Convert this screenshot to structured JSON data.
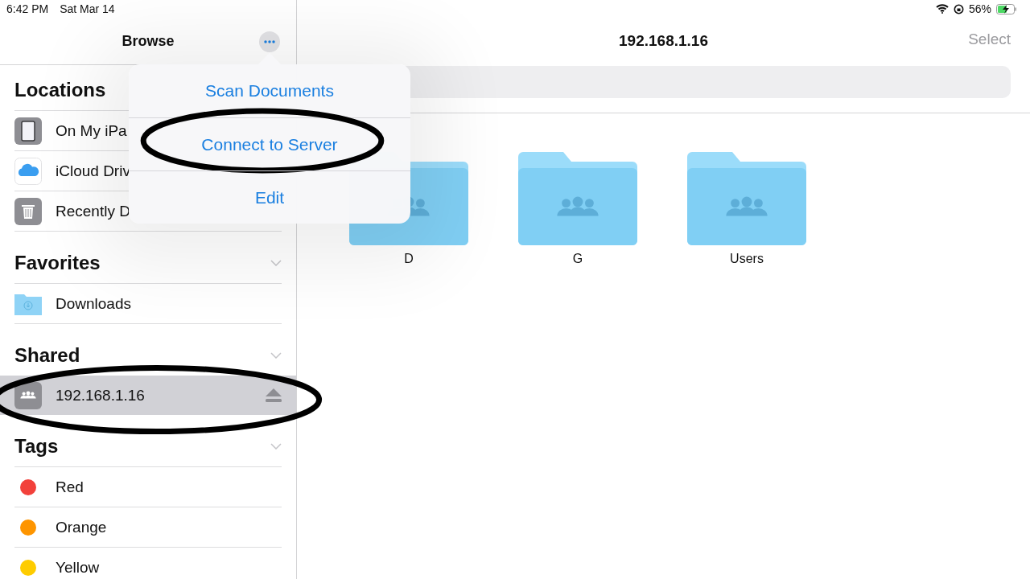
{
  "status_bar": {
    "time": "6:42 PM",
    "date": "Sat Mar 14",
    "battery": "56%",
    "charging": true
  },
  "sidebar": {
    "title": "Browse",
    "sections": [
      {
        "title": "Locations",
        "items": [
          {
            "kind": "device",
            "label": "On My iPa",
            "selected": false,
            "circled": false
          },
          {
            "kind": "cloud",
            "label": "iCloud Driv",
            "selected": false,
            "circled": false
          },
          {
            "kind": "trash",
            "label": "Recently D",
            "selected": false,
            "circled": false
          }
        ]
      },
      {
        "title": "Favorites",
        "chevron": true,
        "items": [
          {
            "kind": "folder",
            "label": "Downloads",
            "selected": false,
            "circled": false
          }
        ]
      },
      {
        "title": "Shared",
        "chevron": true,
        "items": [
          {
            "kind": "server",
            "label": "192.168.1.16",
            "selected": true,
            "circled": true,
            "ejectable": true
          }
        ]
      },
      {
        "title": "Tags",
        "chevron": true,
        "items": [
          {
            "kind": "tag",
            "label": "Red",
            "color": "#f2413b"
          },
          {
            "kind": "tag",
            "label": "Orange",
            "color": "#fe9500"
          },
          {
            "kind": "tag",
            "label": "Yellow",
            "color": "#fecc00"
          }
        ]
      }
    ]
  },
  "content": {
    "title": "192.168.1.16",
    "select": "Select",
    "folders": [
      {
        "name": "D"
      },
      {
        "name": "G"
      },
      {
        "name": "Users"
      }
    ]
  },
  "popover": {
    "items": [
      {
        "label": "Scan Documents",
        "circled": false
      },
      {
        "label": "Connect to Server",
        "circled": true
      },
      {
        "label": "Edit",
        "circled": false
      }
    ]
  }
}
